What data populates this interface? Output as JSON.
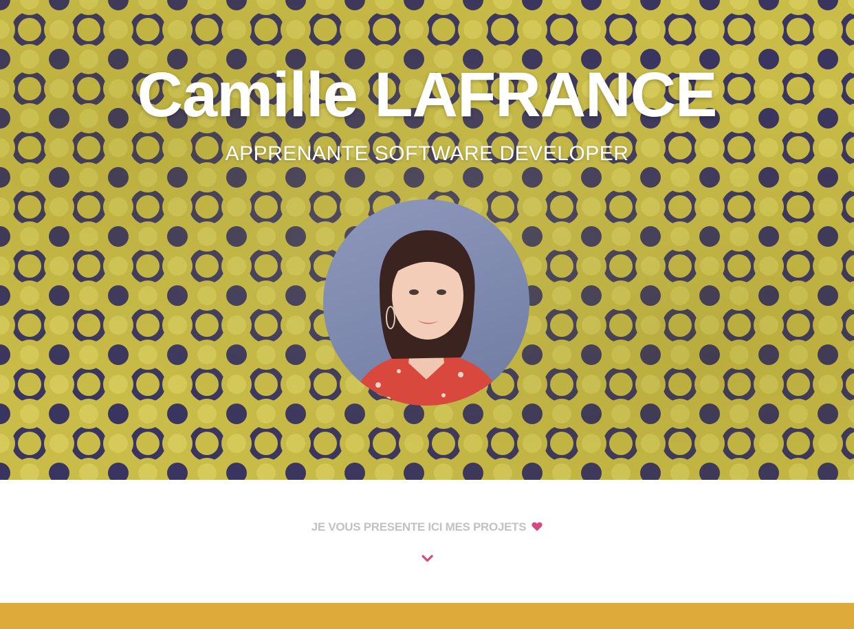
{
  "hero": {
    "title": "Camille LAFRANCE",
    "subtitle": "APPRENANTE SOFTWARE DEVELOPER"
  },
  "projects_intro": {
    "text": "JE VOUS PRESENTE ICI MES PROJETS",
    "icon": "heart-icon",
    "scroll_icon": "chevron-down-icon"
  },
  "colors": {
    "pattern_yellow": "#c8bb45",
    "pattern_navy": "#3a3560",
    "accent_pink": "#d9477f",
    "muted_text": "#c2c2c2",
    "section_gold": "#deaa3a"
  }
}
